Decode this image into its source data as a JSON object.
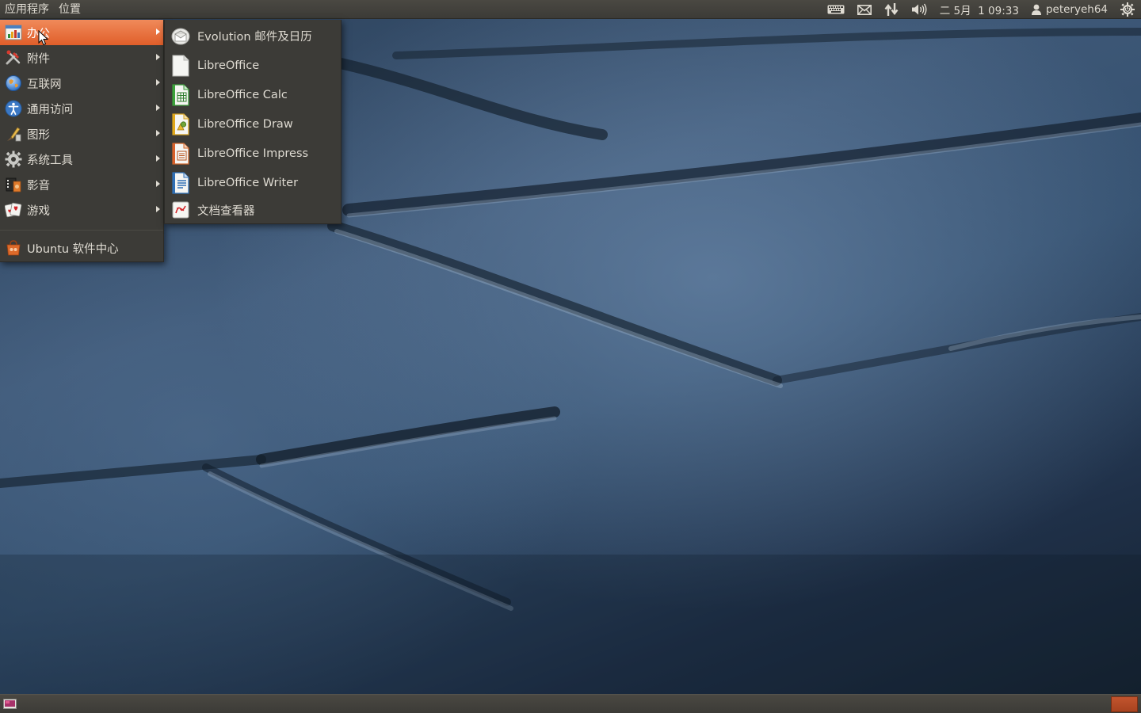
{
  "top_panel": {
    "menus": [
      "应用程序",
      "位置"
    ],
    "indicators": {
      "keyboard_icon": "keyboard-icon",
      "mail_icon": "mail-icon",
      "network_icon": "network-updown-icon",
      "volume_icon": "volume-icon",
      "clock": "二 5月  1 09:33",
      "user_icon": "user-icon",
      "username": "peteryeh64",
      "session_icon": "power-gear-icon"
    }
  },
  "main_menu": {
    "items": [
      {
        "label": "办公",
        "icon": "office-icon",
        "has_submenu": true,
        "active": true
      },
      {
        "label": "附件",
        "icon": "accessories-icon",
        "has_submenu": true
      },
      {
        "label": "互联网",
        "icon": "internet-icon",
        "has_submenu": true
      },
      {
        "label": "通用访问",
        "icon": "accessibility-icon",
        "has_submenu": true
      },
      {
        "label": "图形",
        "icon": "graphics-icon",
        "has_submenu": true
      },
      {
        "label": "系统工具",
        "icon": "system-tools-icon",
        "has_submenu": true
      },
      {
        "label": "影音",
        "icon": "multimedia-icon",
        "has_submenu": true
      },
      {
        "label": "游戏",
        "icon": "games-icon",
        "has_submenu": true
      }
    ],
    "footer_item": {
      "label": "Ubuntu 软件中心",
      "icon": "software-center-icon"
    }
  },
  "sub_menu": {
    "items": [
      {
        "label": "Evolution 邮件及日历",
        "icon": "evolution-icon"
      },
      {
        "label": "LibreOffice",
        "icon": "libreoffice-icon"
      },
      {
        "label": "LibreOffice Calc",
        "icon": "libreoffice-calc-icon"
      },
      {
        "label": "LibreOffice Draw",
        "icon": "libreoffice-draw-icon"
      },
      {
        "label": "LibreOffice Impress",
        "icon": "libreoffice-impress-icon"
      },
      {
        "label": "LibreOffice Writer",
        "icon": "libreoffice-writer-icon"
      },
      {
        "label": "文档查看器",
        "icon": "document-viewer-icon"
      }
    ]
  },
  "bottom_panel": {
    "show_desktop_icon": "show-desktop-icon",
    "trash_icon": "trash-applet-icon"
  },
  "colors": {
    "panel": "#3c3b37",
    "menu_highlight": "#e66a3a",
    "menu_text": "#dfdbd2"
  }
}
